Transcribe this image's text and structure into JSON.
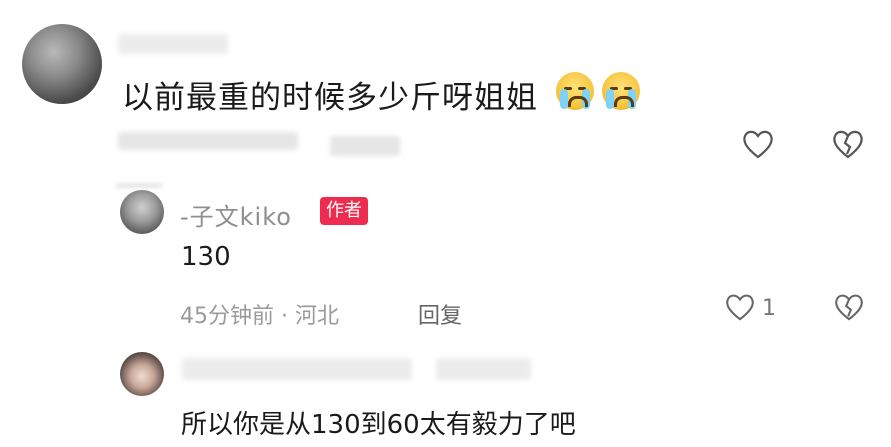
{
  "comment": {
    "text": "以前最重的时候多少斤呀姐姐",
    "emojis": [
      "crying-face-icon",
      "crying-face-icon"
    ]
  },
  "reply": {
    "author": "-子文kiko",
    "badge": "作者",
    "text": "130",
    "meta": "45分钟前 · 河北",
    "reply_label": "回复",
    "like_count": "1"
  },
  "comment2": {
    "text": "所以你是从130到60太有毅力了吧"
  },
  "colors": {
    "badge": "#ee2c4f",
    "meta": "#9a9a9a"
  }
}
